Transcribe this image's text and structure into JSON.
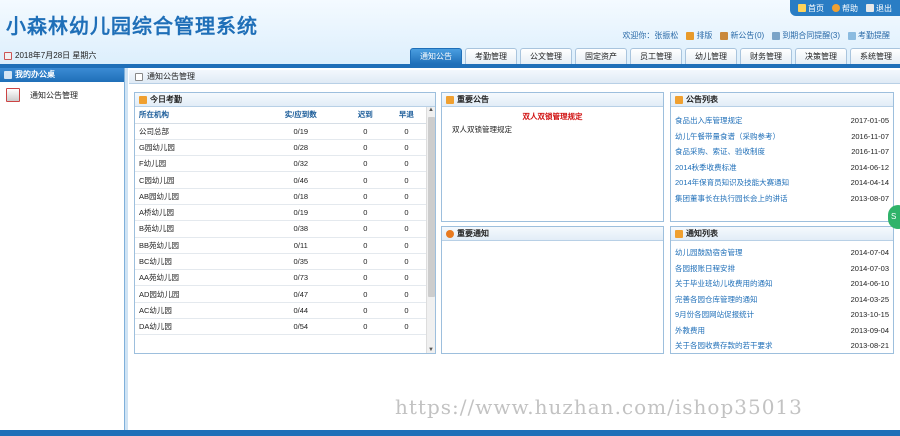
{
  "header": {
    "title": "小森林幼儿园综合管理系统",
    "toplinks": [
      {
        "label": "首页",
        "icon": "home-icon"
      },
      {
        "label": "帮助",
        "icon": "help-icon"
      },
      {
        "label": "退出",
        "icon": "exit-icon"
      }
    ],
    "user": {
      "welcome": "欢迎你：张振松",
      "items": [
        {
          "label": "排版",
          "icon": "layout-icon"
        },
        {
          "label": "新公告(0)",
          "icon": "notice-icon"
        },
        {
          "label": "到期合同提醒(3)",
          "icon": "contract-icon"
        },
        {
          "label": "考勤提醒",
          "icon": "attendance-icon"
        }
      ]
    },
    "date": "2018年7月28日 星期六",
    "tabs": [
      "通知公告",
      "考勤管理",
      "公文管理",
      "固定资产",
      "员工管理",
      "幼儿管理",
      "财务管理",
      "决策管理",
      "系统管理"
    ]
  },
  "sidebar": {
    "title": "我的办公桌",
    "items": [
      {
        "label": "通知公告管理"
      }
    ]
  },
  "breadcrumb": "通知公告管理",
  "attendance": {
    "title": "今日考勤",
    "headers": [
      "所在机构",
      "实/应到数",
      "迟到",
      "早退"
    ],
    "rows": [
      [
        "公司总部",
        "0/19",
        "0",
        "0"
      ],
      [
        "G园幼儿园",
        "0/28",
        "0",
        "0"
      ],
      [
        "F幼儿园",
        "0/32",
        "0",
        "0"
      ],
      [
        "C园幼儿园",
        "0/46",
        "0",
        "0"
      ],
      [
        "AB园幼儿园",
        "0/18",
        "0",
        "0"
      ],
      [
        "A桥幼儿园",
        "0/19",
        "0",
        "0"
      ],
      [
        "B苑幼儿园",
        "0/38",
        "0",
        "0"
      ],
      [
        "BB苑幼儿园",
        "0/11",
        "0",
        "0"
      ],
      [
        "BC幼儿园",
        "0/35",
        "0",
        "0"
      ],
      [
        "AA苑幼儿园",
        "0/73",
        "0",
        "0"
      ],
      [
        "AD园幼儿园",
        "0/47",
        "0",
        "0"
      ],
      [
        "AC幼儿园",
        "0/44",
        "0",
        "0"
      ],
      [
        "DA幼儿园",
        "0/54",
        "0",
        "0"
      ]
    ]
  },
  "important_notice": {
    "title": "重要公告",
    "headline": "双人双锁管理规定",
    "body": "双人双锁管理规定"
  },
  "important_notify": {
    "title": "重要通知"
  },
  "notice_list": {
    "title": "公告列表",
    "items": [
      {
        "t": "食品出入库管理规定",
        "d": "2017-01-05"
      },
      {
        "t": "幼儿午餐带量食谱（采购参考）",
        "d": "2016-11-07"
      },
      {
        "t": "食品采购、索证、验收制度",
        "d": "2016-11-07"
      },
      {
        "t": "2014秋季收费标准",
        "d": "2014-06-12"
      },
      {
        "t": "2014年保育员知识及技能大赛通知",
        "d": "2014-04-14"
      },
      {
        "t": "集团董事长在执行园长会上的讲话",
        "d": "2013-08-07"
      }
    ]
  },
  "notify_list": {
    "title": "通知列表",
    "items": [
      {
        "t": "幼儿园鼓励宿舍管理",
        "d": "2014-07-04"
      },
      {
        "t": "各园报账日程安排",
        "d": "2014-07-03"
      },
      {
        "t": "关于毕业班幼儿收费用的通知",
        "d": "2014-06-10"
      },
      {
        "t": "完善各园仓库管理的通知",
        "d": "2014-03-25"
      },
      {
        "t": "9月份各园网站促报统计",
        "d": "2013-10-15"
      },
      {
        "t": "外教费用",
        "d": "2013-09-04"
      },
      {
        "t": "关于各园收费存款的若干要求",
        "d": "2013-08-21"
      }
    ]
  },
  "watermark": "https://www.huzhan.com/ishop35013",
  "colors": {
    "brand": "#1f6fb8",
    "alert": "#d01010"
  }
}
